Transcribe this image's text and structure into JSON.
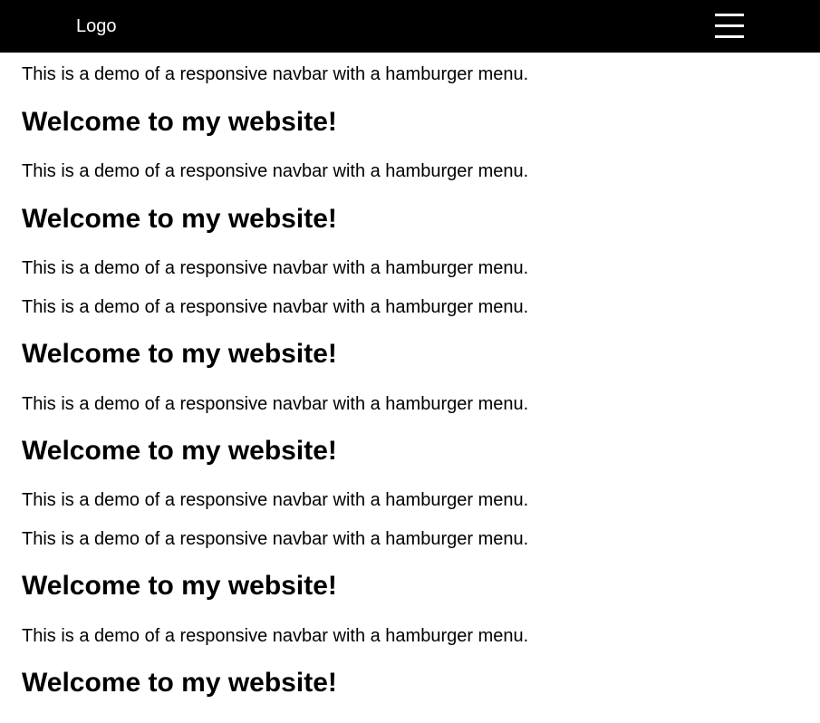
{
  "navbar": {
    "logo": "Logo",
    "menu_icon": "hamburger-menu-icon",
    "background": "#000000",
    "foreground": "#ffffff"
  },
  "content": {
    "blocks": [
      {
        "type": "paragraph",
        "text": "This is a demo of a responsive navbar with a hamburger menu."
      },
      {
        "type": "heading",
        "text": "Welcome to my website!"
      },
      {
        "type": "paragraph",
        "text": "This is a demo of a responsive navbar with a hamburger menu."
      },
      {
        "type": "heading",
        "text": "Welcome to my website!"
      },
      {
        "type": "paragraph",
        "text": "This is a demo of a responsive navbar with a hamburger menu."
      },
      {
        "type": "paragraph",
        "text": "This is a demo of a responsive navbar with a hamburger menu."
      },
      {
        "type": "heading",
        "text": "Welcome to my website!"
      },
      {
        "type": "paragraph",
        "text": "This is a demo of a responsive navbar with a hamburger menu."
      },
      {
        "type": "heading",
        "text": "Welcome to my website!"
      },
      {
        "type": "paragraph",
        "text": "This is a demo of a responsive navbar with a hamburger menu."
      },
      {
        "type": "paragraph",
        "text": "This is a demo of a responsive navbar with a hamburger menu."
      },
      {
        "type": "heading",
        "text": "Welcome to my website!"
      },
      {
        "type": "paragraph",
        "text": "This is a demo of a responsive navbar with a hamburger menu."
      },
      {
        "type": "heading",
        "text": "Welcome to my website!"
      }
    ]
  }
}
